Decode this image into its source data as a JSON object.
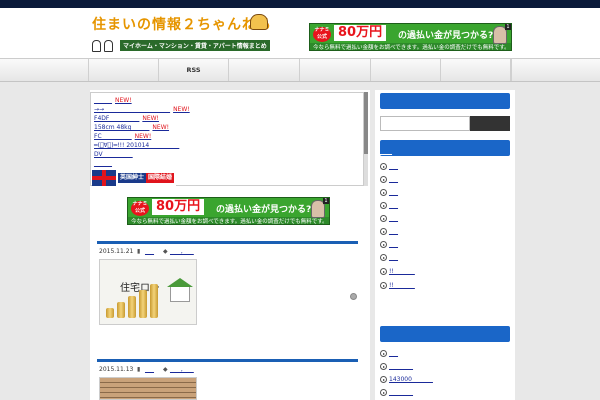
{
  "header": {
    "logo_main": "住まいの情報２ちゃんねる",
    "logo_sub": "マイホーム・マンション・賃貸・アパート情報まとめ",
    "ad_tag": "ナナミ公式",
    "ad_amount": "80万円",
    "ad_text": "の過払い金が見つかる?!",
    "ad_sub": "今なら無料で過払い金額をお調べできます。過払い金の調査だけでも無料です。",
    "ad_num": "1"
  },
  "nav": {
    "items": [
      "",
      "RSS",
      "",
      "",
      "",
      "",
      "",
      ""
    ]
  },
  "latest": {
    "new_label": "NEW!",
    "links": [
      {
        "text": "______",
        "new": true
      },
      {
        "text": "→→______________________",
        "new": true
      },
      {
        "text": "F4DF__________",
        "new": true
      },
      {
        "text": "158cm 48kg______",
        "new": true
      },
      {
        "text": "FC__________",
        "new": true
      },
      {
        "text": "━(ﾟ∀ﾟ)━!!! 201014__________",
        "new": false
      },
      {
        "text": "DV__________",
        "new": false
      },
      {
        "text": "______",
        "new": false
      }
    ],
    "flag_text": "英国紳士",
    "flag_text2": "国際結婚"
  },
  "posts": [
    {
      "date": "2015.11.21",
      "cat1": "___",
      "cat2": "___ , ___",
      "thumb_text": "住宅ロー"
    },
    {
      "date": "2015.11.13",
      "cat1": "___",
      "cat2": "___ , ___"
    }
  ],
  "sidebar": {
    "search_placeholder": "",
    "heading_link": "____",
    "items1": [
      "___",
      "___",
      "___",
      "___",
      "___",
      "___",
      "___",
      "___",
      "!!_______"
    ],
    "items2": [
      "___",
      "________",
      "143000_______",
      "________"
    ]
  },
  "colors": {
    "accent": "#1a66c8",
    "new": "#e0141c",
    "logo": "#e69500",
    "ad_green": "#3aa52f"
  }
}
